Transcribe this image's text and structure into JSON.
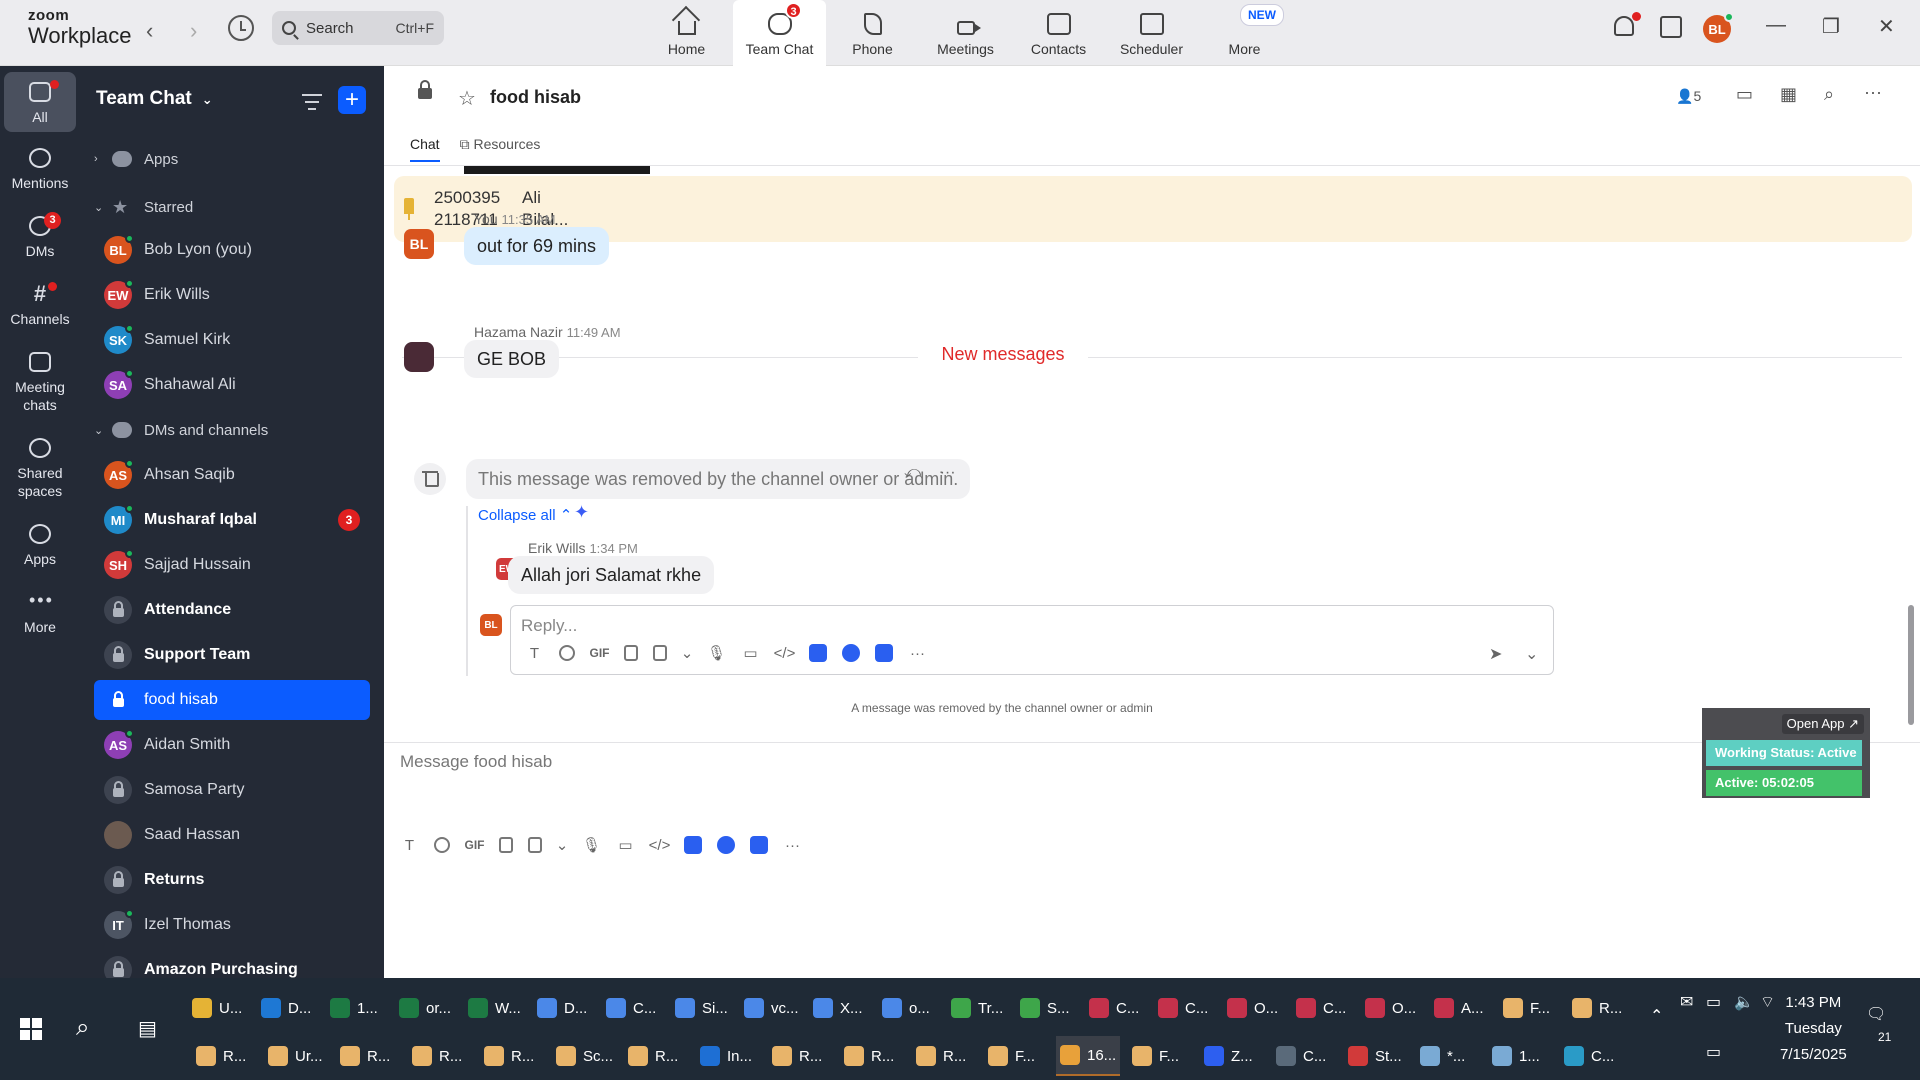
{
  "app": {
    "brand_top": "zoom",
    "brand_bottom": "Workplace"
  },
  "search": {
    "label": "Search",
    "shortcut": "Ctrl+F"
  },
  "top_tabs": [
    {
      "label": "Home",
      "icon": "home-icon"
    },
    {
      "label": "Team Chat",
      "icon": "chat-icon",
      "badge": "3",
      "active": true
    },
    {
      "label": "Phone",
      "icon": "phone-icon"
    },
    {
      "label": "Meetings",
      "icon": "video-icon"
    },
    {
      "label": "Contacts",
      "icon": "contacts-icon"
    },
    {
      "label": "Scheduler",
      "icon": "scheduler-icon"
    },
    {
      "label": "More",
      "icon": "more-icon"
    }
  ],
  "new_badge": "NEW",
  "top_avatar": "BL",
  "rail": [
    {
      "label": "All",
      "active": true
    },
    {
      "label": "Mentions"
    },
    {
      "label": "DMs",
      "badge": "3"
    },
    {
      "label": "Channels"
    },
    {
      "label": "Meeting chats"
    },
    {
      "label": "Shared spaces"
    },
    {
      "label": "Apps"
    },
    {
      "label": "More"
    }
  ],
  "sidebar": {
    "title": "Team Chat",
    "sections": {
      "apps": "Apps",
      "starred": "Starred",
      "dms": "DMs and channels"
    },
    "items": [
      {
        "type": "person",
        "label": "Bob Lyon (you)",
        "initials": "BL",
        "color": "#d9541e"
      },
      {
        "type": "person",
        "label": "Erik Wills",
        "initials": "EW",
        "color": "#d13a3a"
      },
      {
        "type": "person",
        "label": "Samuel Kirk",
        "initials": "SK",
        "color": "#1f8ac9"
      },
      {
        "type": "person",
        "label": "Shahawal Ali",
        "initials": "SA",
        "color": "#8e3fb5"
      },
      {
        "type": "person",
        "label": "Ahsan Saqib",
        "initials": "AS",
        "color": "#d9541e"
      },
      {
        "type": "person",
        "label": "Musharaf Iqbal",
        "initials": "MI",
        "color": "#1f8ac9",
        "bold": true,
        "count": "3"
      },
      {
        "type": "person",
        "label": "Sajjad Hussain",
        "initials": "SH",
        "color": "#d13a3a"
      },
      {
        "type": "channel",
        "label": "Attendance",
        "bold": true
      },
      {
        "type": "channel",
        "label": "Support Team",
        "bold": true
      },
      {
        "type": "channel",
        "label": "food hisab",
        "selected": true
      },
      {
        "type": "person",
        "label": "Aidan Smith",
        "initials": "AS",
        "color": "#8e3fb5"
      },
      {
        "type": "channel",
        "label": "Samosa Party"
      },
      {
        "type": "photo",
        "label": "Saad Hassan"
      },
      {
        "type": "channel",
        "label": "Returns",
        "bold": true
      },
      {
        "type": "person",
        "label": "Izel Thomas",
        "initials": "IT",
        "color": "#4d5563"
      },
      {
        "type": "channel",
        "label": "Amazon Purchasing",
        "bold": true
      }
    ]
  },
  "channel": {
    "name": "food hisab",
    "member_count": "5",
    "tabs": [
      "Chat",
      "Resources"
    ]
  },
  "pinned": [
    {
      "id": "2500395",
      "name": "Ali"
    },
    {
      "id": "2118711",
      "name": "Bilal..."
    }
  ],
  "messages": {
    "m1": {
      "author": "You",
      "time": "11:35 AM",
      "text": "out for 69 mins",
      "initials": "BL"
    },
    "new_messages_label": "New messages",
    "m2": {
      "author": "Hazama Nazir",
      "time": "11:49 AM",
      "text": "GE BOB"
    },
    "removed": "This message was removed by the channel owner or admin.",
    "collapse_label": "Collapse all",
    "reply": {
      "author": "Erik Wills",
      "time": "1:34 PM",
      "text": "Allah jori Salamat rkhe",
      "initials": "EW"
    },
    "reply_placeholder": "Reply...",
    "removed_notice": "A message was removed by the channel owner or admin",
    "reply_avatar": "BL"
  },
  "composer": {
    "placeholder": "Message food hisab",
    "gif": "GIF"
  },
  "status_widget": {
    "open_app": "Open App ↗",
    "working_status": "Working Status: Active",
    "active_timer": "Active: 05:02:05"
  },
  "taskbar": {
    "row1": [
      "U...",
      "D...",
      "1...",
      "or...",
      "W...",
      "D...",
      "C...",
      "Si...",
      "vc...",
      "X...",
      "o...",
      "Tr...",
      "S...",
      "C...",
      "C...",
      "O...",
      "C...",
      "O...",
      "A...",
      "F...",
      "R..."
    ],
    "row2": [
      "R...",
      "Ur...",
      "R...",
      "R...",
      "R...",
      "Sc...",
      "R...",
      "In...",
      "R...",
      "R...",
      "R...",
      "F...",
      "16...",
      "F...",
      "Z...",
      "C...",
      "St...",
      "*...",
      "1...",
      "C..."
    ],
    "clock_time": "1:43 PM",
    "clock_day": "Tuesday",
    "clock_date": "7/15/2025",
    "notif_count": "21"
  }
}
